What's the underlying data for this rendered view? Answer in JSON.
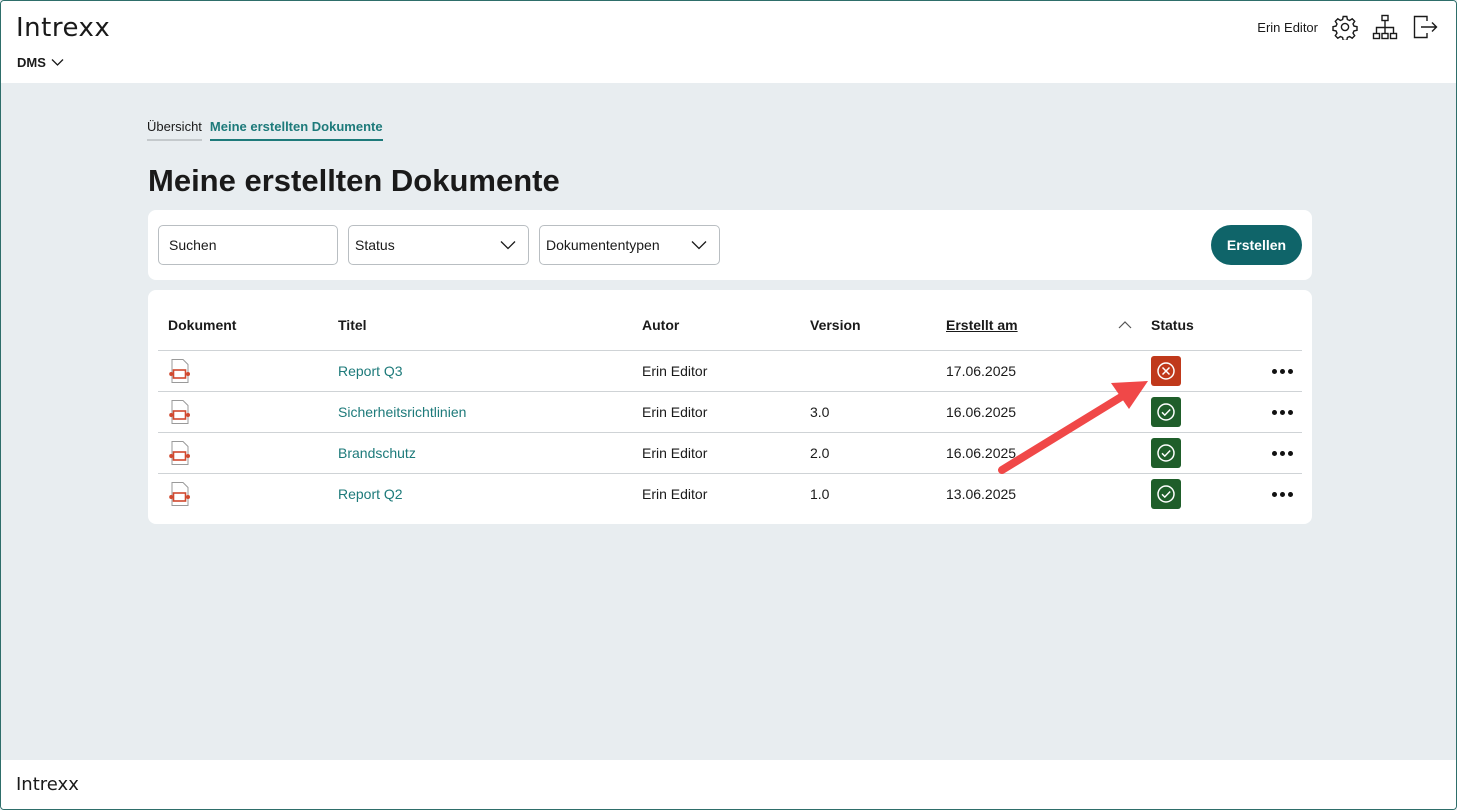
{
  "header": {
    "logo": "Intrexx",
    "app_switch_label": "DMS",
    "user_name": "Erin Editor",
    "icons": [
      "gear-icon",
      "sitemap-icon",
      "logout-icon"
    ]
  },
  "tabs": [
    {
      "label": "Übersicht",
      "active": false
    },
    {
      "label": "Meine erstellten Dokumente",
      "active": true
    }
  ],
  "page_title": "Meine erstellten Dokumente",
  "filters": {
    "search_value": "Suchen",
    "status_selected": "Status",
    "types_selected": "Dokumententypen",
    "create_label": "Erstellen"
  },
  "table": {
    "headers": {
      "document": "Dokument",
      "title": "Titel",
      "author": "Autor",
      "version": "Version",
      "created": "Erstellt am",
      "status": "Status"
    },
    "rows": [
      {
        "title": "Report Q3",
        "author": "Erin Editor",
        "version": "",
        "created": "17.06.2025",
        "status": "rejected"
      },
      {
        "title": "Sicherheitsrichtlinien",
        "author": "Erin Editor",
        "version": "3.0",
        "created": "16.06.2025",
        "status": "approved"
      },
      {
        "title": "Brandschutz",
        "author": "Erin Editor",
        "version": "2.0",
        "created": "16.06.2025",
        "status": "approved"
      },
      {
        "title": "Report Q2",
        "author": "Erin Editor",
        "version": "1.0",
        "created": "13.06.2025",
        "status": "approved"
      }
    ]
  },
  "colors": {
    "accent": "#1d7a7a",
    "button": "#0f6469",
    "status_rejected": "#c0391b",
    "status_approved": "#1f5e2a",
    "annotation_arrow": "#f04848"
  },
  "footer": {
    "logo": "Intrexx"
  }
}
